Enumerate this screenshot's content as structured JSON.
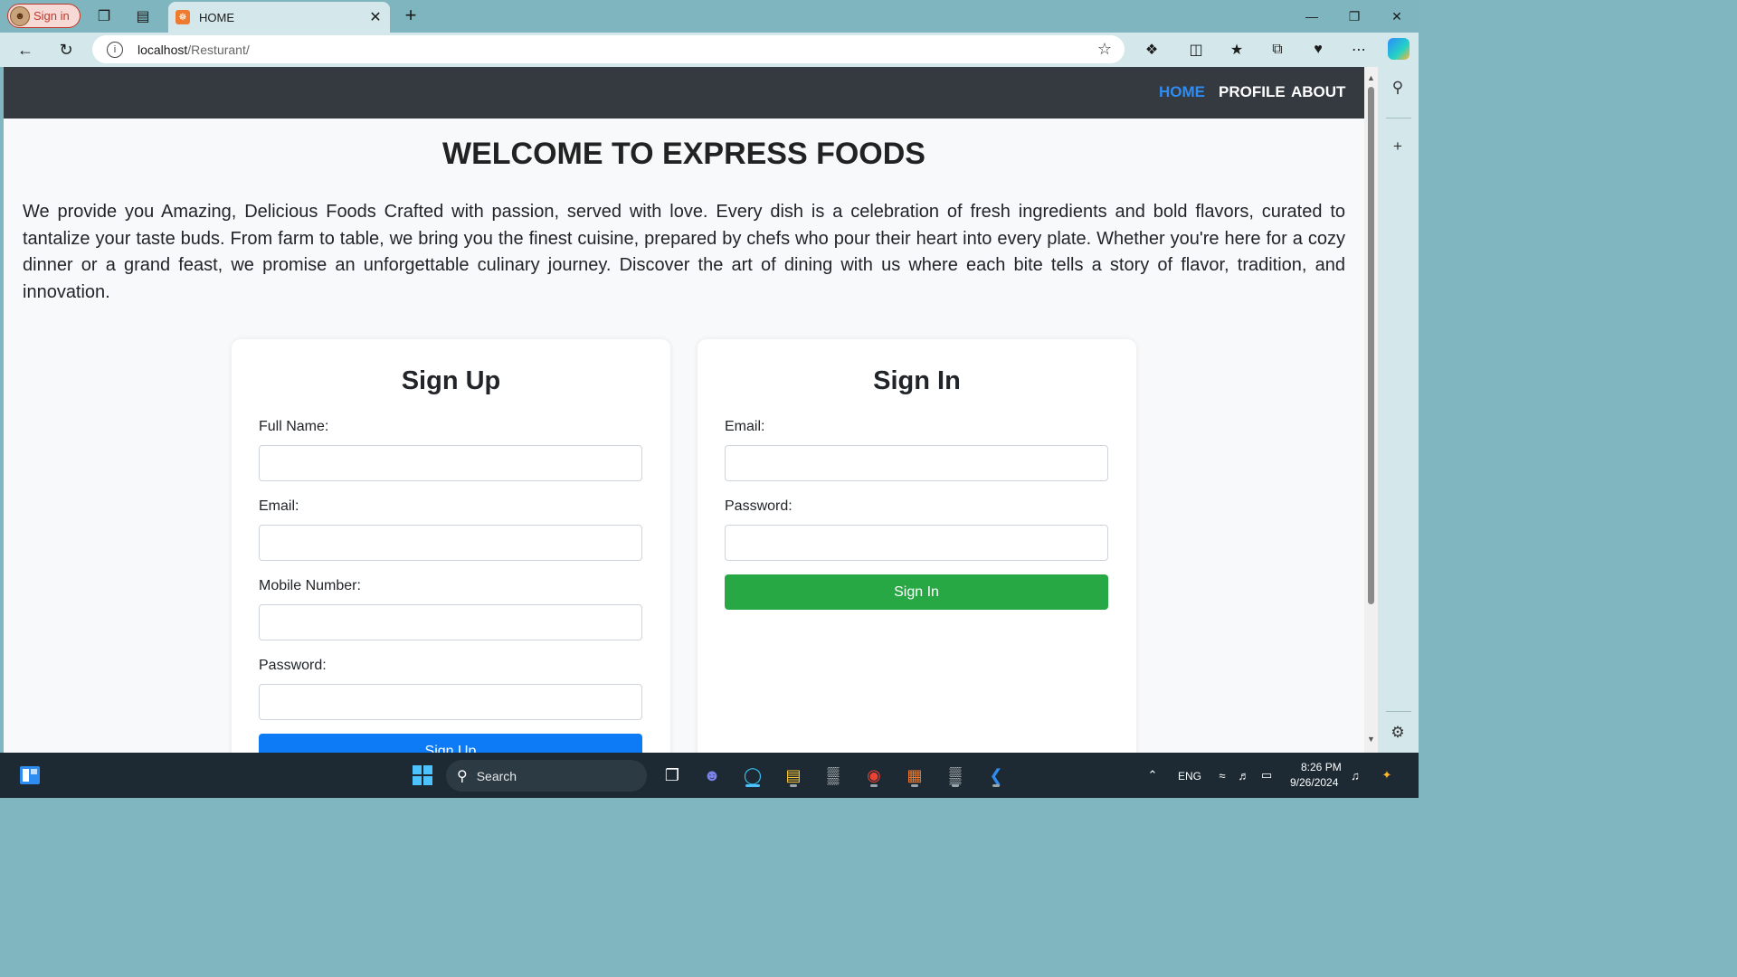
{
  "browser": {
    "profile_label": "Sign in",
    "tab_title": "HOME",
    "tab_favicon": "☸",
    "url_host": "localhost",
    "url_path": "/Resturant/"
  },
  "site": {
    "nav": [
      "HOME",
      "PROFILE",
      "ABOUT"
    ],
    "title": "WELCOME TO EXPRESS FOODS",
    "intro": "We provide you Amazing, Delicious Foods Crafted with passion, served with love. Every dish is a celebration of fresh ingredients and bold flavors, curated to tantalize your taste buds. From farm to table, we bring you the finest cuisine, prepared by chefs who pour their heart into every plate. Whether you're here for a cozy dinner or a grand feast, we promise an unforgettable culinary journey. Discover the art of dining with us where each bite tells a story of flavor, tradition, and innovation."
  },
  "signup": {
    "title": "Sign Up",
    "fields": [
      "Full Name:",
      "Email:",
      "Mobile Number:",
      "Password:"
    ],
    "button": "Sign Up"
  },
  "signin": {
    "title": "Sign In",
    "fields": [
      "Email:",
      "Password:"
    ],
    "button": "Sign In"
  },
  "taskbar": {
    "search_label": "Search",
    "language": "ENG",
    "time": "8:26 PM",
    "date": "9/26/2024"
  },
  "colors": {
    "nav_bg": "#343a40",
    "nav_active": "#2f8cf0",
    "signin_button": "#28a745",
    "signup_button": "#0d7af6"
  }
}
